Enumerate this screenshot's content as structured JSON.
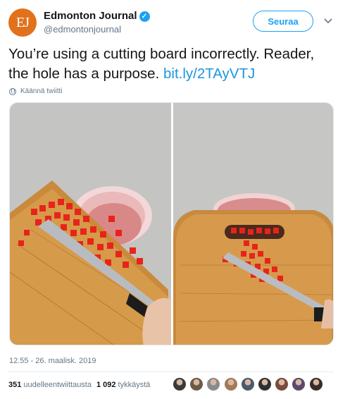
{
  "author": {
    "avatar_initials": "EJ",
    "name": "Edmonton Journal",
    "handle": "@edmontonjournal",
    "verified": true
  },
  "follow_label": "Seuraa",
  "tweet": {
    "text": "You’re using a cutting board incorrectly. Reader, the hole has a purpose.",
    "link": "bit.ly/2TAyVTJ"
  },
  "translate_label": "Käännä twiitti",
  "timestamp": "12.55 - 26. maalisk. 2019",
  "stats": {
    "retweets_count": "351",
    "retweets_label": "uudelleentwiittausta",
    "likes_count": "1 092",
    "likes_label": "tykkäystä"
  },
  "likers": [
    {
      "color": "#3a3a3a"
    },
    {
      "color": "#6b5a4a"
    },
    {
      "color": "#8a8a8a"
    },
    {
      "color": "#a07a5a"
    },
    {
      "color": "#4a5a6a"
    },
    {
      "color": "#2f2f2f"
    },
    {
      "color": "#7a4a3a"
    },
    {
      "color": "#5a4a6a"
    },
    {
      "color": "#3a2a2a"
    }
  ],
  "colors": {
    "brand": "#1da1f2",
    "link": "#1b95e0",
    "avatar": "#e2711c"
  }
}
